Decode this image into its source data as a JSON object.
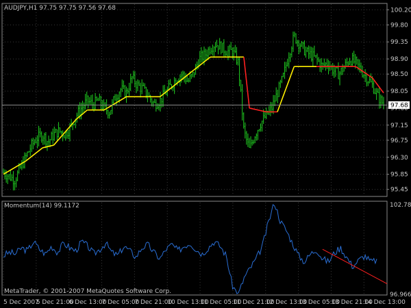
{
  "main_panel": {
    "header": "AUDJPY,H1  97.75 97.75 97.56 97.68",
    "y_ticks": [
      "100.20",
      "99.80",
      "99.35",
      "98.90",
      "98.50",
      "98.05",
      "97.60",
      "97.15",
      "96.75",
      "96.30",
      "95.85",
      "95.45"
    ],
    "current_price_label": "97.68",
    "current_price": 97.68,
    "colors": {
      "background": "#000000",
      "grid": "#3a3a3a",
      "candles": "#20d020",
      "trend_up": "#ffee00",
      "trend_down": "#ff2020"
    }
  },
  "indicator_panel": {
    "header": "Momentum(14) 99.1172",
    "max_label": "102.7843",
    "min_label": "96.9667",
    "footer": "MetaTrader, © 2001-2007 MetaQuotes Software Corp.",
    "colors": {
      "line": "#2a6fd6",
      "trend": "#ff2020"
    }
  },
  "x_axis": {
    "labels": [
      "5 Dec 2007",
      "5 Dec 21:00",
      "6 Dec 13:00",
      "7 Dec 05:00",
      "7 Dec 21:00",
      "10 Dec 13:00",
      "11 Dec 05:00",
      "11 Dec 21:00",
      "12 Dec 13:00",
      "13 Dec 05:00",
      "13 Dec 21:00",
      "14 Dec 13:00"
    ]
  },
  "chart_data": {
    "type": "candlestick",
    "symbol": "AUDJPY",
    "timeframe": "H1",
    "ylim": [
      95.3,
      100.35
    ],
    "close_path": [
      95.9,
      95.8,
      95.7,
      96.0,
      96.3,
      96.6,
      96.8,
      96.9,
      96.7,
      96.9,
      97.0,
      96.9,
      97.1,
      97.4,
      97.6,
      97.8,
      97.7,
      97.8,
      97.6,
      97.5,
      97.9,
      98.1,
      98.0,
      98.4,
      98.2,
      98.1,
      97.9,
      97.7,
      97.8,
      98.0,
      98.2,
      98.4,
      98.5,
      98.3,
      98.5,
      98.9,
      99.0,
      99.2,
      99.3,
      99.2,
      99.1,
      99.1,
      98.8,
      97.0,
      96.5,
      96.9,
      97.2,
      97.4,
      97.6,
      98.0,
      98.4,
      99.0,
      99.5,
      99.3,
      99.1,
      99.0,
      98.9,
      98.7,
      98.8,
      98.6,
      98.5,
      98.7,
      98.9,
      98.8,
      98.6,
      98.4,
      98.2,
      97.9,
      97.7
    ],
    "trend_line": [
      {
        "t": 0,
        "v": 95.85,
        "c": "up"
      },
      {
        "t": 4,
        "v": 96.2,
        "c": "up"
      },
      {
        "t": 7,
        "v": 96.55,
        "c": "up"
      },
      {
        "t": 9,
        "v": 96.62,
        "c": "up"
      },
      {
        "t": 13,
        "v": 97.3,
        "c": "up"
      },
      {
        "t": 15,
        "v": 97.55,
        "c": "up"
      },
      {
        "t": 18,
        "v": 97.55,
        "c": "up"
      },
      {
        "t": 22,
        "v": 97.9,
        "c": "up"
      },
      {
        "t": 28,
        "v": 97.9,
        "c": "up"
      },
      {
        "t": 34,
        "v": 98.6,
        "c": "up"
      },
      {
        "t": 37,
        "v": 98.95,
        "c": "up"
      },
      {
        "t": 43,
        "v": 98.95,
        "c": "down"
      },
      {
        "t": 44,
        "v": 97.6,
        "c": "down"
      },
      {
        "t": 47,
        "v": 97.5,
        "c": "down"
      },
      {
        "t": 49,
        "v": 97.5,
        "c": "up"
      },
      {
        "t": 52,
        "v": 98.7,
        "c": "up"
      },
      {
        "t": 56,
        "v": 98.7,
        "c": "down"
      },
      {
        "t": 63,
        "v": 98.7,
        "c": "down"
      },
      {
        "t": 66,
        "v": 98.4,
        "c": "down"
      },
      {
        "t": 68,
        "v": 98.0,
        "c": "down"
      }
    ],
    "momentum": [
      99.4,
      99.6,
      99.5,
      99.9,
      99.7,
      100.3,
      99.8,
      99.5,
      100.0,
      99.6,
      100.2,
      99.9,
      99.7,
      100.3,
      100.0,
      99.5,
      99.8,
      100.2,
      99.6,
      99.4,
      100.0,
      99.7,
      99.3,
      99.9,
      100.1,
      99.6,
      99.2,
      99.8,
      100.1,
      99.7,
      100.0,
      100.2,
      99.8,
      99.5,
      99.9,
      100.3,
      100.0,
      99.4,
      97.5,
      96.9,
      98.0,
      98.6,
      99.2,
      100.0,
      101.5,
      102.8,
      101.6,
      101.0,
      100.2,
      99.4,
      99.0,
      99.5,
      99.8,
      99.2,
      99.0,
      99.6,
      99.9,
      99.3,
      98.7,
      99.1,
      99.4,
      99.0,
      99.1
    ],
    "momentum_ylim": [
      96.9667,
      102.7843
    ],
    "momentum_trend": [
      {
        "t": 53,
        "v": 99.8
      },
      {
        "t": 62,
        "v": 97.6
      }
    ]
  }
}
